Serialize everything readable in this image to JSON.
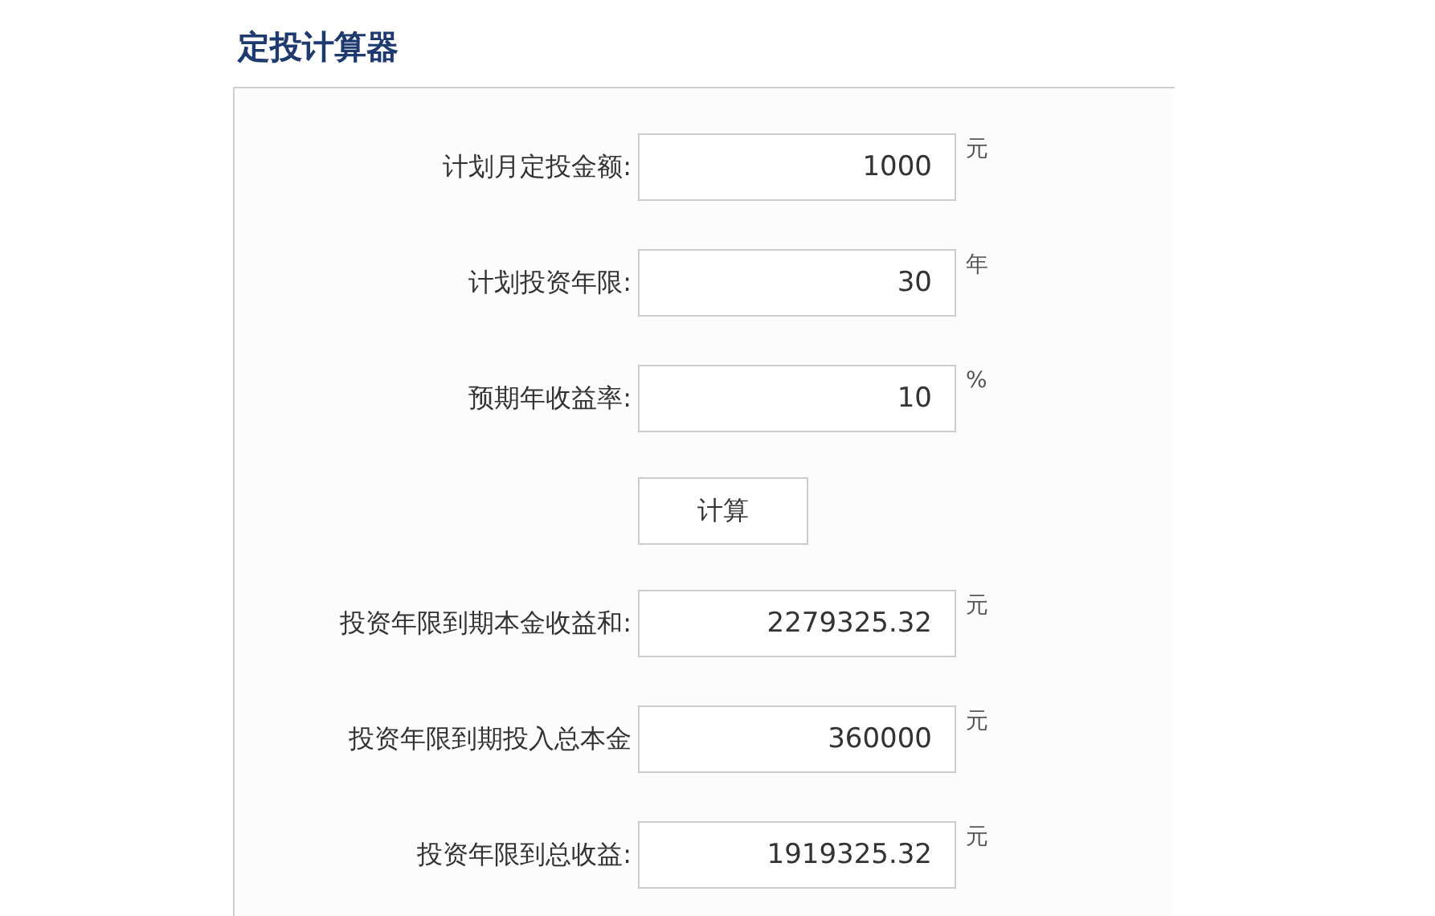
{
  "title": "定投计算器",
  "inputs": [
    {
      "label": "计划月定投金额:",
      "value": "1000",
      "unit": "元"
    },
    {
      "label": "计划投资年限:",
      "value": "30",
      "unit": "年"
    },
    {
      "label": "预期年收益率:",
      "value": "10",
      "unit": "%"
    }
  ],
  "button": "计算",
  "results": [
    {
      "label": "投资年限到期本金收益和:",
      "value": "2279325.32",
      "unit": "元"
    },
    {
      "label": "投资年限到期投入总本金",
      "value": "360000",
      "unit": "元"
    },
    {
      "label": "投资年限到总收益:",
      "value": "1919325.32",
      "unit": "元"
    }
  ]
}
